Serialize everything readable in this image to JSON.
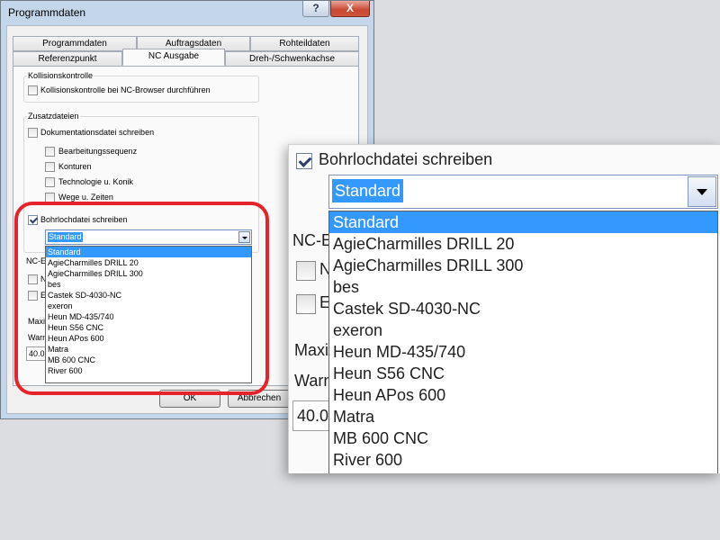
{
  "dialog": {
    "title": "Programmdaten",
    "help_label": "?",
    "close_label": "X",
    "tabs_row1": [
      "Programmdaten",
      "Auftragsdaten",
      "Rohteildaten"
    ],
    "tabs_row2": [
      "Referenzpunkt",
      "NC Ausgabe",
      "Dreh-/Schwenkachse"
    ],
    "active_tab": "NC Ausgabe",
    "kollision": {
      "group_label": "Kollisionskontrolle",
      "checkbox_label": "Kollisionskontrolle bei NC-Browser durchführen"
    },
    "zusatz": {
      "group_label": "Zusatzdateien",
      "doc_label": "Dokumentationsdatei schreiben",
      "sub_items": [
        "Bearbeitungssequenz",
        "Konturen",
        "Technologie u. Konik",
        "Wege u. Zeiten"
      ],
      "bohr_label": "Bohrlochdatei schreiben",
      "bohr_checked": true,
      "combo_value": "Standard"
    },
    "partial": {
      "nc_frag": "NC-E",
      "n_frag": "N",
      "e_frag": "E",
      "maxi_frag": "Maxi",
      "warn_frag": "Warn",
      "num_frag": "40.0"
    },
    "ok_label": "OK",
    "cancel_label": "Abbrechen"
  },
  "dropdown_options": [
    "Standard",
    "AgieCharmilles DRILL 20",
    "AgieCharmilles DRILL 300",
    "bes",
    "Castek SD-4030-NC",
    "exeron",
    "Heun MD-435/740",
    "Heun S56 CNC",
    "Heun APos 600",
    "Matra",
    "MB 600 CNC",
    "River 600"
  ],
  "highlighted_option": "Standard",
  "zoom": {
    "checkbox_label": "Bohrlochdatei schreiben",
    "combo_value": "Standard",
    "nc_frag": "NC-E",
    "n_frag": "N",
    "e_frag": "E",
    "maxi_frag": "Maxi",
    "warn_frag": "Warn",
    "num_frag": "40.0"
  },
  "colors": {
    "selection": "#3399ff",
    "highlight_ring": "#e5232a",
    "title_bar": "#c3d6ea"
  }
}
